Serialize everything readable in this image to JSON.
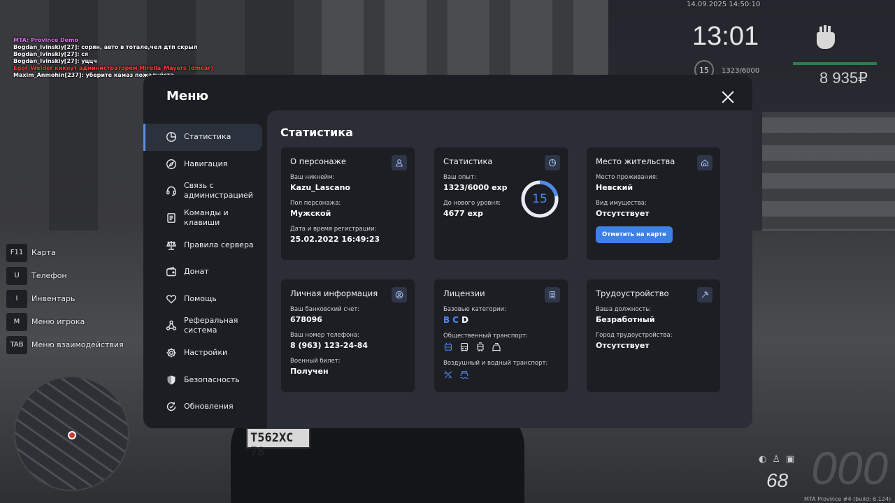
{
  "chat": [
    {
      "text": "MTA: Province Demo",
      "color": "#e06cf0"
    },
    {
      "text": "Bogdan_Ivinskiy[27]: сорян, авто в тотале,чел дтп скрыл",
      "color": "#ffffff"
    },
    {
      "text": "Bogdan_Ivinskiy[27]: ся",
      "color": "#ffffff"
    },
    {
      "text": "Bogdan_Ivinskiy[27]: уццч",
      "color": "#ffffff"
    },
    {
      "text": "Egor_Welder кикнут администратором Mirella_Mayers (dmcar)",
      "color": "#ff3b3b"
    },
    {
      "text": "Maxim_Anmohin[237]: уберите камаз пожалуйста",
      "color": "#ffffff"
    }
  ],
  "hud": {
    "datetime": "14.09.2025 14:50:10",
    "clock": "13:01",
    "level": "15",
    "exp": "1323/6000",
    "money": "8 935₽",
    "speed": "000",
    "fuel": "68",
    "build": "MTA Province #4 (build: 6.124)"
  },
  "plate": "Т562ХС 78",
  "hotkeys": [
    {
      "key": "F11",
      "label": "Карта"
    },
    {
      "key": "U",
      "label": "Телефон"
    },
    {
      "key": "I",
      "label": "Инвентарь"
    },
    {
      "key": "M",
      "label": "Меню игрока"
    },
    {
      "key": "TAB",
      "label": "Меню взаимодействия"
    }
  ],
  "menu": {
    "title": "Меню",
    "nav": [
      {
        "label": "Статистика",
        "icon": "pie-chart-icon",
        "active": true
      },
      {
        "label": "Навигация",
        "icon": "compass-icon"
      },
      {
        "label": "Связь с администрацией",
        "icon": "headset-icon"
      },
      {
        "label": "Команды и клавиши",
        "icon": "document-icon"
      },
      {
        "label": "Правила сервера",
        "icon": "scales-icon"
      },
      {
        "label": "Донат",
        "icon": "wallet-icon"
      },
      {
        "label": "Помощь",
        "icon": "heart-hands-icon"
      },
      {
        "label": "Реферальная система",
        "icon": "network-icon"
      },
      {
        "label": "Настройки",
        "icon": "gear-icon"
      },
      {
        "label": "Безопасность",
        "icon": "shield-icon"
      },
      {
        "label": "Обновления",
        "icon": "refresh-icon"
      }
    ],
    "content_title": "Статистика",
    "character": {
      "title": "О персонаже",
      "nickname_label": "Ваш никнейм:",
      "nickname": "Kazu_Lascano",
      "gender_label": "Пол персонажа:",
      "gender": "Мужской",
      "reg_label": "Дата и время регистрации:",
      "reg": "25.02.2022 16:49:23"
    },
    "stats": {
      "title": "Статистика",
      "exp_label": "Ваш опыт:",
      "exp": "1323/6000 exp",
      "next_label": "До нового уровня:",
      "next": "4677 exp",
      "level": "15",
      "progress": 0.2205,
      "accent": "#4d8af0"
    },
    "residence": {
      "title": "Место жительства",
      "place_label": "Место проживания:",
      "place": "Невский",
      "property_label": "Вид имущества:",
      "property": "Отсутствует",
      "button": "Отметить на карте"
    },
    "personal": {
      "title": "Личная информация",
      "bank_label": "Ваш банковский счет:",
      "bank": "678096",
      "phone_label": "Ваш номер телефона:",
      "phone": "8 (963) 123-24-84",
      "military_label": "Военный билет:",
      "military": "Получен"
    },
    "licenses": {
      "title": "Лицензии",
      "base_label": "Базовые категории:",
      "categories": [
        {
          "letter": "B",
          "active": true
        },
        {
          "letter": "C",
          "active": true
        },
        {
          "letter": "D",
          "active": false
        }
      ],
      "public_label": "Общественный транспорт:",
      "air_label": "Воздушный и водный транспорт:"
    },
    "job": {
      "title": "Трудоустройство",
      "position_label": "Ваша должность:",
      "position": "Безработный",
      "city_label": "Город трудоустройства:",
      "city": "Отсутствует"
    }
  }
}
